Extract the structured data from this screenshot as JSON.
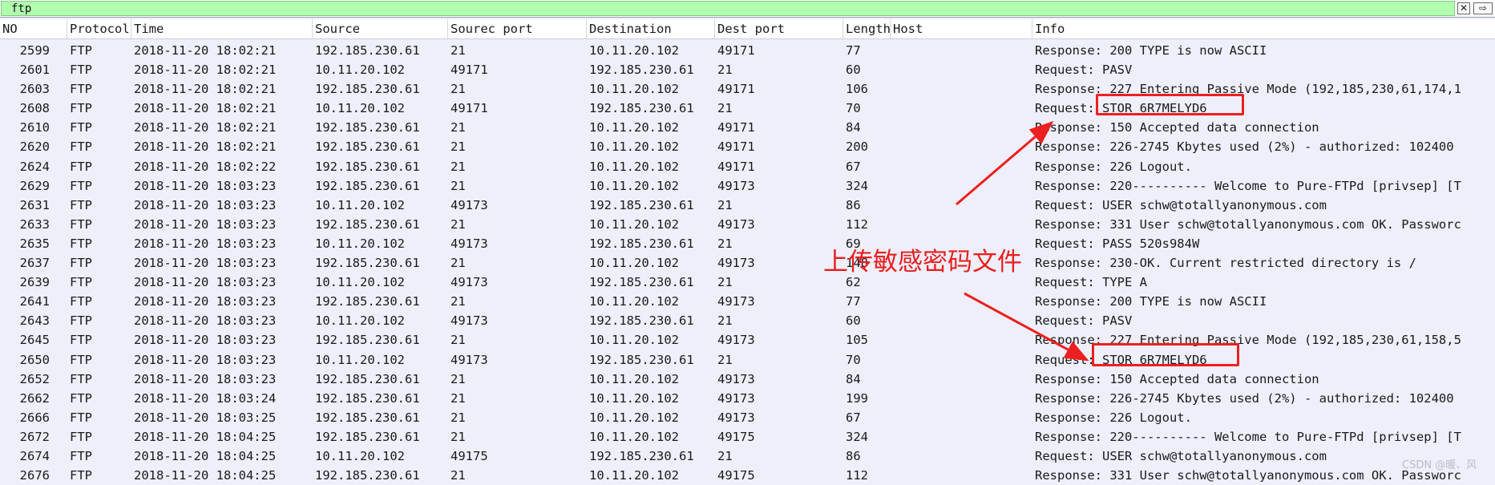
{
  "filter": {
    "value": "ftp",
    "clear_glyph": "✕",
    "apply_glyph": "⇨"
  },
  "columns": {
    "no": "NO",
    "protocol": "Protocol",
    "time": "Time",
    "source": "Source",
    "source_port": "Sourec port",
    "destination": "Destination",
    "dest_port": "Dest port",
    "length": "Length",
    "host": "Host",
    "info": "Info"
  },
  "packets": [
    {
      "no": "2599",
      "proto": "FTP",
      "time": "2018-11-20 18:02:21",
      "src": "192.185.230.61",
      "sport": "21",
      "dst": "10.11.20.102",
      "dport": "49171",
      "len": "77",
      "info": "Response: 200 TYPE is now ASCII"
    },
    {
      "no": "2601",
      "proto": "FTP",
      "time": "2018-11-20 18:02:21",
      "src": "10.11.20.102",
      "sport": "49171",
      "dst": "192.185.230.61",
      "dport": "21",
      "len": "60",
      "info": "Request: PASV"
    },
    {
      "no": "2603",
      "proto": "FTP",
      "time": "2018-11-20 18:02:21",
      "src": "192.185.230.61",
      "sport": "21",
      "dst": "10.11.20.102",
      "dport": "49171",
      "len": "106",
      "info": "Response: 227 Entering Passive Mode (192,185,230,61,174,1"
    },
    {
      "no": "2608",
      "proto": "FTP",
      "time": "2018-11-20 18:02:21",
      "src": "10.11.20.102",
      "sport": "49171",
      "dst": "192.185.230.61",
      "dport": "21",
      "len": "70",
      "info": "Request: STOR 6R7MELYD6"
    },
    {
      "no": "2610",
      "proto": "FTP",
      "time": "2018-11-20 18:02:21",
      "src": "192.185.230.61",
      "sport": "21",
      "dst": "10.11.20.102",
      "dport": "49171",
      "len": "84",
      "info": "Response: 150 Accepted data connection"
    },
    {
      "no": "2620",
      "proto": "FTP",
      "time": "2018-11-20 18:02:21",
      "src": "192.185.230.61",
      "sport": "21",
      "dst": "10.11.20.102",
      "dport": "49171",
      "len": "200",
      "info": "Response: 226-2745 Kbytes used (2%) - authorized: 102400"
    },
    {
      "no": "2624",
      "proto": "FTP",
      "time": "2018-11-20 18:02:22",
      "src": "192.185.230.61",
      "sport": "21",
      "dst": "10.11.20.102",
      "dport": "49171",
      "len": "67",
      "info": "Response: 226 Logout."
    },
    {
      "no": "2629",
      "proto": "FTP",
      "time": "2018-11-20 18:03:23",
      "src": "192.185.230.61",
      "sport": "21",
      "dst": "10.11.20.102",
      "dport": "49173",
      "len": "324",
      "info": "Response: 220---------- Welcome to Pure-FTPd [privsep] [T"
    },
    {
      "no": "2631",
      "proto": "FTP",
      "time": "2018-11-20 18:03:23",
      "src": "10.11.20.102",
      "sport": "49173",
      "dst": "192.185.230.61",
      "dport": "21",
      "len": "86",
      "info": "Request: USER schw@totallyanonymous.com"
    },
    {
      "no": "2633",
      "proto": "FTP",
      "time": "2018-11-20 18:03:23",
      "src": "192.185.230.61",
      "sport": "21",
      "dst": "10.11.20.102",
      "dport": "49173",
      "len": "112",
      "info": "Response: 331 User schw@totallyanonymous.com OK. Passworc"
    },
    {
      "no": "2635",
      "proto": "FTP",
      "time": "2018-11-20 18:03:23",
      "src": "10.11.20.102",
      "sport": "49173",
      "dst": "192.185.230.61",
      "dport": "21",
      "len": "69",
      "info": "Request: PASS 520s984W"
    },
    {
      "no": "2637",
      "proto": "FTP",
      "time": "2018-11-20 18:03:23",
      "src": "192.185.230.61",
      "sport": "21",
      "dst": "10.11.20.102",
      "dport": "49173",
      "len": "148",
      "info": "Response: 230-OK. Current restricted directory is /"
    },
    {
      "no": "2639",
      "proto": "FTP",
      "time": "2018-11-20 18:03:23",
      "src": "10.11.20.102",
      "sport": "49173",
      "dst": "192.185.230.61",
      "dport": "21",
      "len": "62",
      "info": "Request: TYPE A"
    },
    {
      "no": "2641",
      "proto": "FTP",
      "time": "2018-11-20 18:03:23",
      "src": "192.185.230.61",
      "sport": "21",
      "dst": "10.11.20.102",
      "dport": "49173",
      "len": "77",
      "info": "Response: 200 TYPE is now ASCII"
    },
    {
      "no": "2643",
      "proto": "FTP",
      "time": "2018-11-20 18:03:23",
      "src": "10.11.20.102",
      "sport": "49173",
      "dst": "192.185.230.61",
      "dport": "21",
      "len": "60",
      "info": "Request: PASV"
    },
    {
      "no": "2645",
      "proto": "FTP",
      "time": "2018-11-20 18:03:23",
      "src": "192.185.230.61",
      "sport": "21",
      "dst": "10.11.20.102",
      "dport": "49173",
      "len": "105",
      "info": "Response: 227 Entering Passive Mode (192,185,230,61,158,5"
    },
    {
      "no": "2650",
      "proto": "FTP",
      "time": "2018-11-20 18:03:23",
      "src": "10.11.20.102",
      "sport": "49173",
      "dst": "192.185.230.61",
      "dport": "21",
      "len": "70",
      "info": "Request: STOR 6R7MELYD6"
    },
    {
      "no": "2652",
      "proto": "FTP",
      "time": "2018-11-20 18:03:23",
      "src": "192.185.230.61",
      "sport": "21",
      "dst": "10.11.20.102",
      "dport": "49173",
      "len": "84",
      "info": "Response: 150 Accepted data connection"
    },
    {
      "no": "2662",
      "proto": "FTP",
      "time": "2018-11-20 18:03:24",
      "src": "192.185.230.61",
      "sport": "21",
      "dst": "10.11.20.102",
      "dport": "49173",
      "len": "199",
      "info": "Response: 226-2745 Kbytes used (2%) - authorized: 102400"
    },
    {
      "no": "2666",
      "proto": "FTP",
      "time": "2018-11-20 18:03:25",
      "src": "192.185.230.61",
      "sport": "21",
      "dst": "10.11.20.102",
      "dport": "49173",
      "len": "67",
      "info": "Response: 226 Logout."
    },
    {
      "no": "2672",
      "proto": "FTP",
      "time": "2018-11-20 18:04:25",
      "src": "192.185.230.61",
      "sport": "21",
      "dst": "10.11.20.102",
      "dport": "49175",
      "len": "324",
      "info": "Response: 220---------- Welcome to Pure-FTPd [privsep] [T"
    },
    {
      "no": "2674",
      "proto": "FTP",
      "time": "2018-11-20 18:04:25",
      "src": "10.11.20.102",
      "sport": "49175",
      "dst": "192.185.230.61",
      "dport": "21",
      "len": "86",
      "info": "Request: USER schw@totallyanonymous.com"
    },
    {
      "no": "2676",
      "proto": "FTP",
      "time": "2018-11-20 18:04:25",
      "src": "192.185.230.61",
      "sport": "21",
      "dst": "10.11.20.102",
      "dport": "49175",
      "len": "112",
      "info": "Response: 331 User schw@totallyanonymous.com OK. Passworc"
    }
  ],
  "annotation": {
    "label": "上传敏感密码文件",
    "color": "#ec2020"
  },
  "watermark": "CSDN @暖、风"
}
